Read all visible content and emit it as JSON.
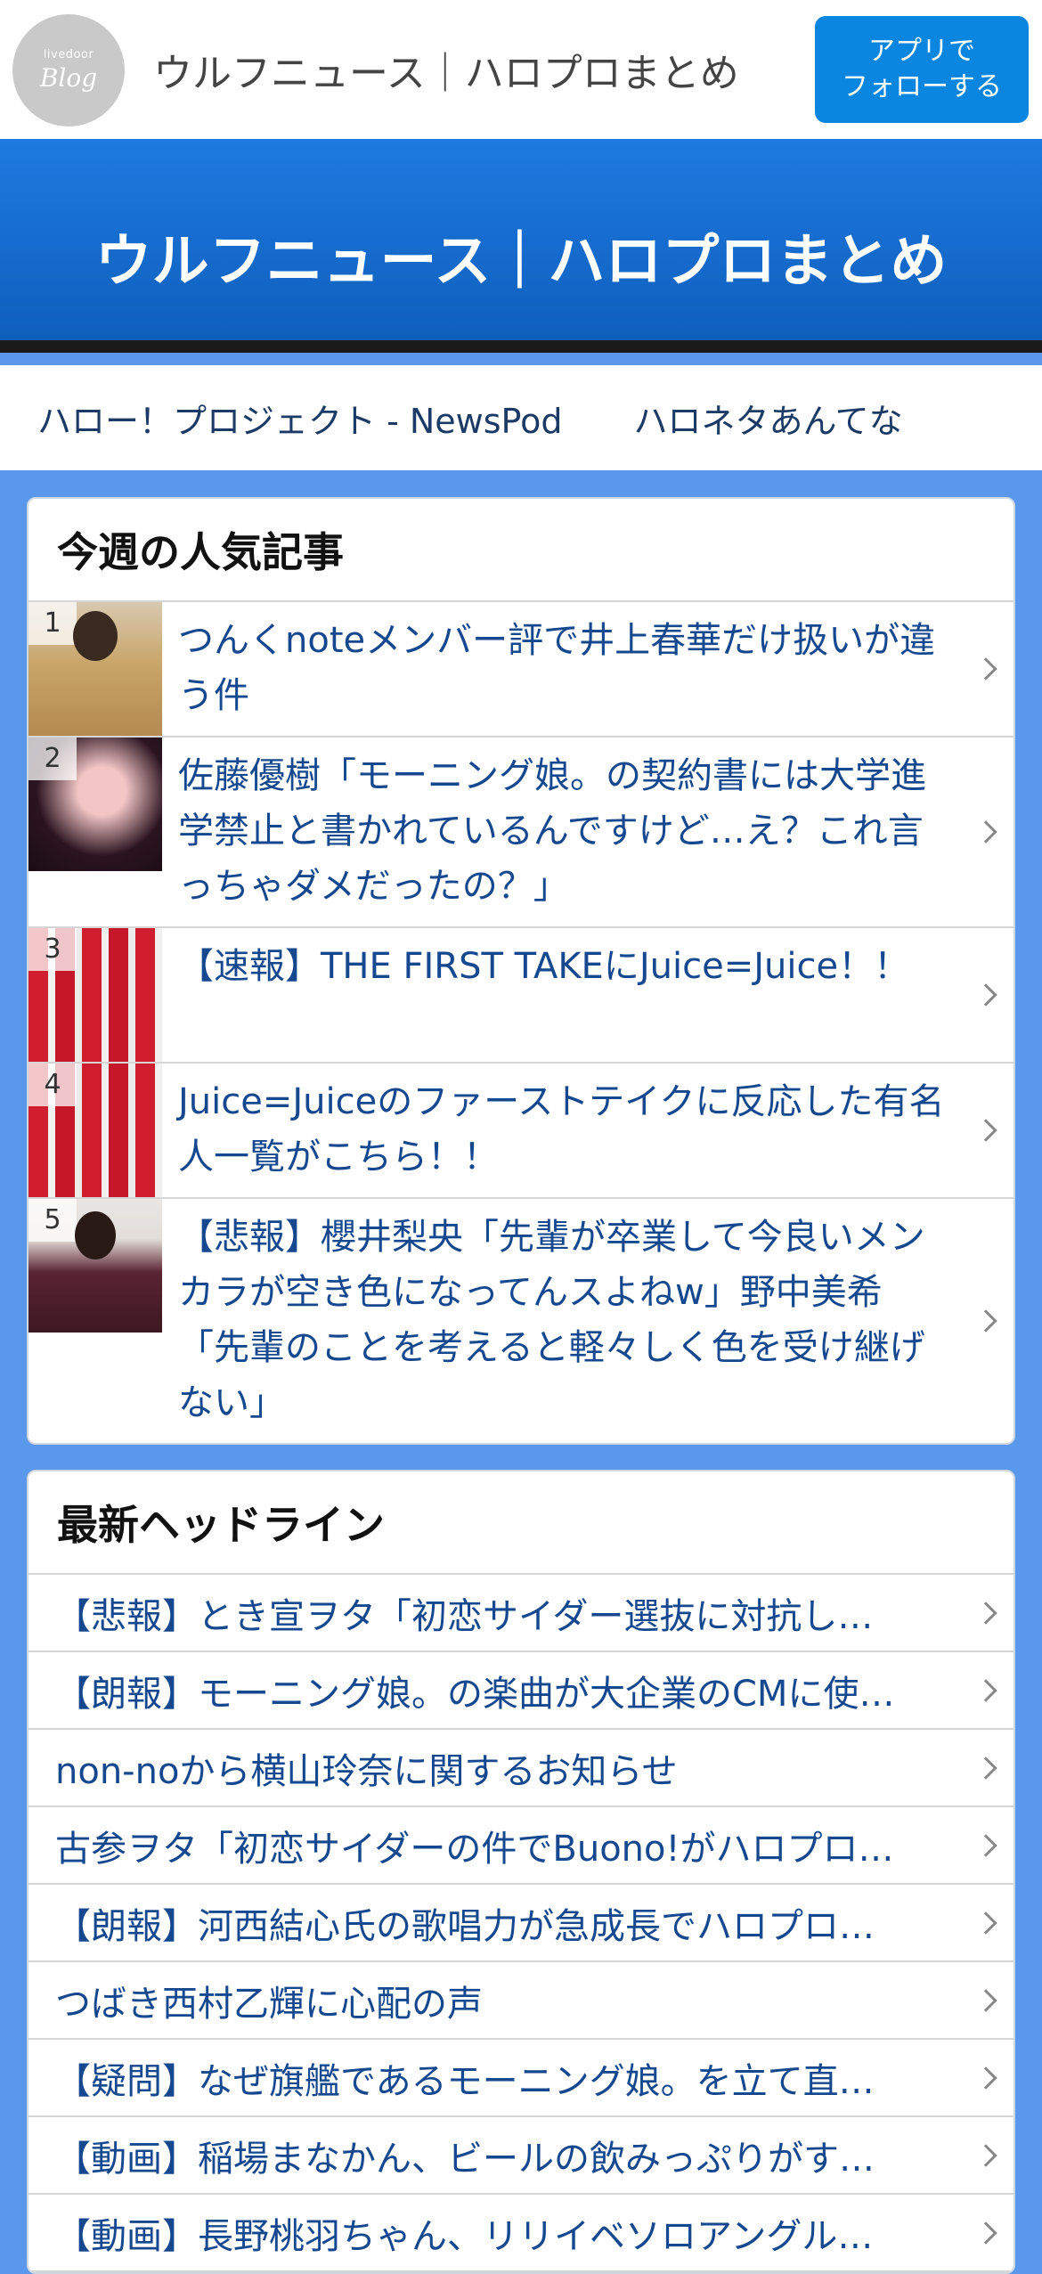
{
  "topbar": {
    "logo_small": "livedoor",
    "logo_big": "Blog",
    "site_name": "ウルフニュース｜ハロプロまとめ",
    "follow_line1": "アプリで",
    "follow_line2": "フォローする"
  },
  "banner": {
    "title": "ウルフニュース｜ハロプロまとめ"
  },
  "links": [
    "ハロー！プロジェクト - NewsPod",
    "ハロネタあんてな"
  ],
  "popular": {
    "title": "今週の人気記事",
    "items": [
      {
        "rank": "1",
        "text": "つんくnoteメンバー評で井上春華だけ扱いが違う件"
      },
      {
        "rank": "2",
        "text": "佐藤優樹「モーニング娘。の契約書には大学進学禁止と書かれているんですけど…え？これ言っちゃダメだったの？」"
      },
      {
        "rank": "3",
        "text": "【速報】THE FIRST TAKEにJuice=Juice！！"
      },
      {
        "rank": "4",
        "text": "Juice=Juiceのファーストテイクに反応した有名人一覧がこちら！！"
      },
      {
        "rank": "5",
        "text": "【悲報】櫻井梨央「先輩が卒業して今良いメンカラが空き色になってんスよねw」野中美希「先輩のことを考えると軽々しく色を受け継げない」"
      }
    ]
  },
  "headlines": {
    "title": "最新ヘッドライン",
    "items": [
      "【悲報】とき宣ヲタ「初恋サイダー選抜に対抗し…",
      "【朗報】モーニング娘。の楽曲が大企業のCMに使…",
      "non-noから横山玲奈に関するお知らせ",
      "古参ヲタ「初恋サイダーの件でBuono!がハロプロ…",
      "【朗報】河西結心氏の歌唱力が急成長でハロプロ…",
      "つばき西村乙輝に心配の声",
      "【疑問】なぜ旗艦であるモーニング娘。を立て直…",
      "【動画】稲場まなかん、ビールの飲みっぷりがす…",
      "【動画】長野桃羽ちゃん、リリイベソロアングル…"
    ]
  }
}
